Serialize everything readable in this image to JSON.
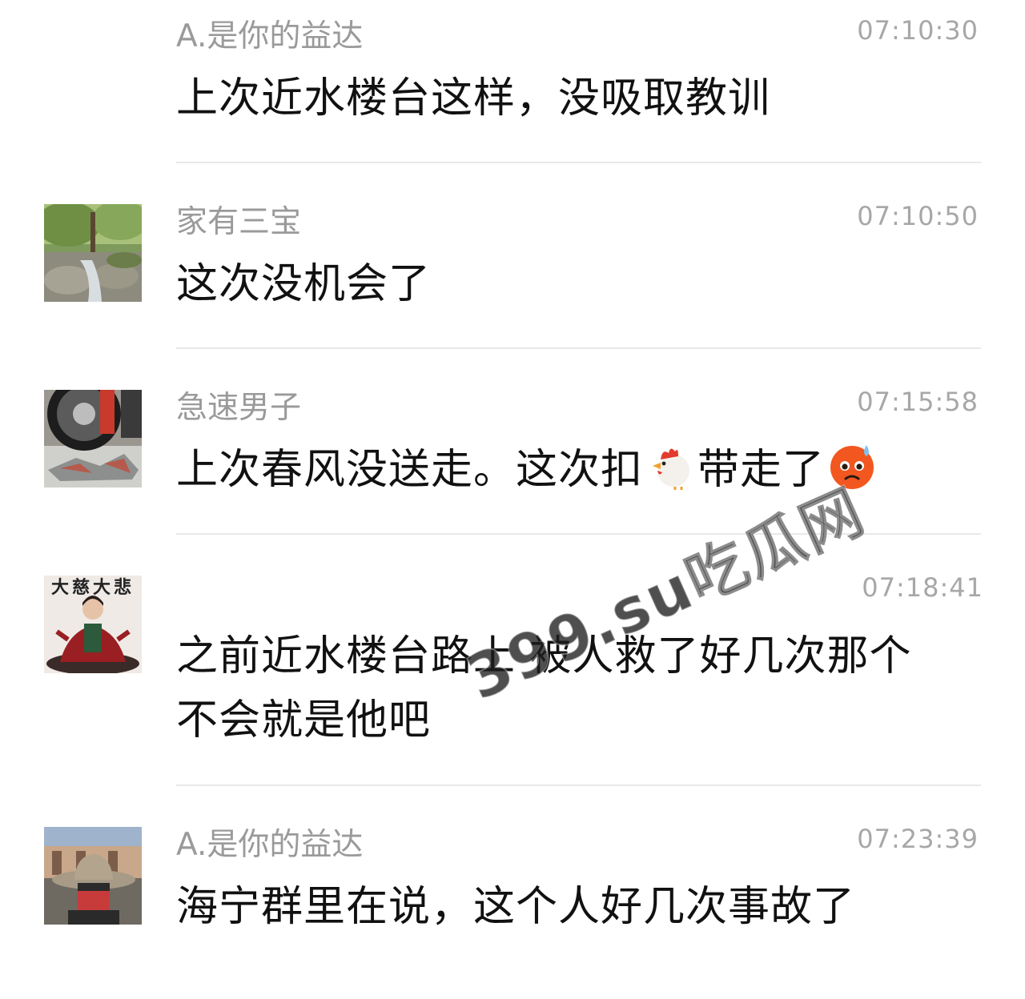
{
  "messages": [
    {
      "sender": "A.是你的益达",
      "time": "07:10:30",
      "text": "上次近水楼台这样，没吸取教训",
      "avatar": "none"
    },
    {
      "sender": "家有三宝",
      "time": "07:10:50",
      "text": "这次没机会了",
      "avatar": "forest-stream-avatar"
    },
    {
      "sender": "急速男子",
      "time": "07:15:58",
      "text_before": "上次春风没送走。这次扣",
      "emoji1": "chicken-emoji",
      "text_middle": "带走了",
      "emoji2": "anxious-face-emoji",
      "avatar": "motorcycle-avatar"
    },
    {
      "sender": "",
      "time": "07:18:41",
      "text_line1": "之前近水楼台路上 被人救了好几次那个",
      "text_line2": "不会就是他吧",
      "avatar": "meditation-avatar",
      "avatar_text": "大慈大悲"
    },
    {
      "sender": "A.是你的益达",
      "time": "07:23:39",
      "text": "海宁群里在说，这个人好几次事故了",
      "avatar": "hat-man-avatar"
    }
  ],
  "watermark": "399.su吃瓜网",
  "colors": {
    "sender": "#9a9a9a",
    "time": "#a7a7a7",
    "text": "#111111",
    "divider": "#e8e8e8"
  }
}
